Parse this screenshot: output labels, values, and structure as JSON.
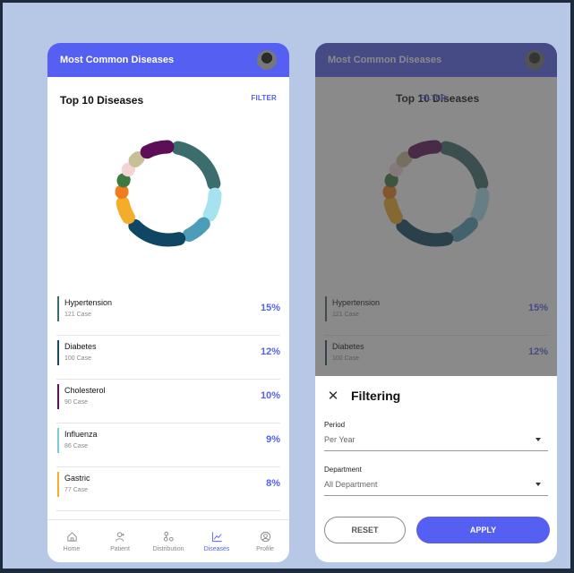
{
  "app_title": "Most Common Diseases",
  "section_title": "Top 10 Diseases",
  "filter_label": "FILTER",
  "diseases": [
    {
      "name": "Hypertension",
      "cases": "121 Case",
      "pct": "15%",
      "color": "#3a6d6c"
    },
    {
      "name": "Diabetes",
      "cases": "100 Case",
      "pct": "12%",
      "color": "#1c4a63"
    },
    {
      "name": "Cholesterol",
      "cases": "90 Case",
      "pct": "10%",
      "color": "#5a1450"
    },
    {
      "name": "Influenza",
      "cases": "86 Case",
      "pct": "9%",
      "color": "#7fc6d8"
    },
    {
      "name": "Gastric",
      "cases": "77 Case",
      "pct": "8%",
      "color": "#f3ad2a"
    }
  ],
  "donut_segments": [
    {
      "color": "#3a6d6c",
      "fraction": 0.22
    },
    {
      "color": "#a7e3ef",
      "fraction": 0.11
    },
    {
      "color": "#4d9cb8",
      "fraction": 0.1
    },
    {
      "color": "#0f4663",
      "fraction": 0.2
    },
    {
      "color": "#f3ad2a",
      "fraction": 0.09
    },
    {
      "color": "#ef7d1f",
      "fraction": 0.04
    },
    {
      "color": "#3b7a41",
      "fraction": 0.04
    },
    {
      "color": "#f6d4d6",
      "fraction": 0.04
    },
    {
      "color": "#c7bf95",
      "fraction": 0.05
    },
    {
      "color": "#5c0f57",
      "fraction": 0.11
    }
  ],
  "nav": [
    {
      "label": "Home",
      "icon": "home-icon",
      "active": false
    },
    {
      "label": "Patient",
      "icon": "patient-icon",
      "active": false
    },
    {
      "label": "Distribution",
      "icon": "distribution-icon",
      "active": false
    },
    {
      "label": "Diseases",
      "icon": "chart-icon",
      "active": true
    },
    {
      "label": "Profile",
      "icon": "profile-icon",
      "active": false
    }
  ],
  "filter_sheet": {
    "title": "Filtering",
    "period_label": "Period",
    "period_value": "Per Year",
    "department_label": "Department",
    "department_value": "All Department",
    "reset_label": "RESET",
    "apply_label": "APPLY"
  },
  "colors": {
    "brand": "#5560f2"
  }
}
